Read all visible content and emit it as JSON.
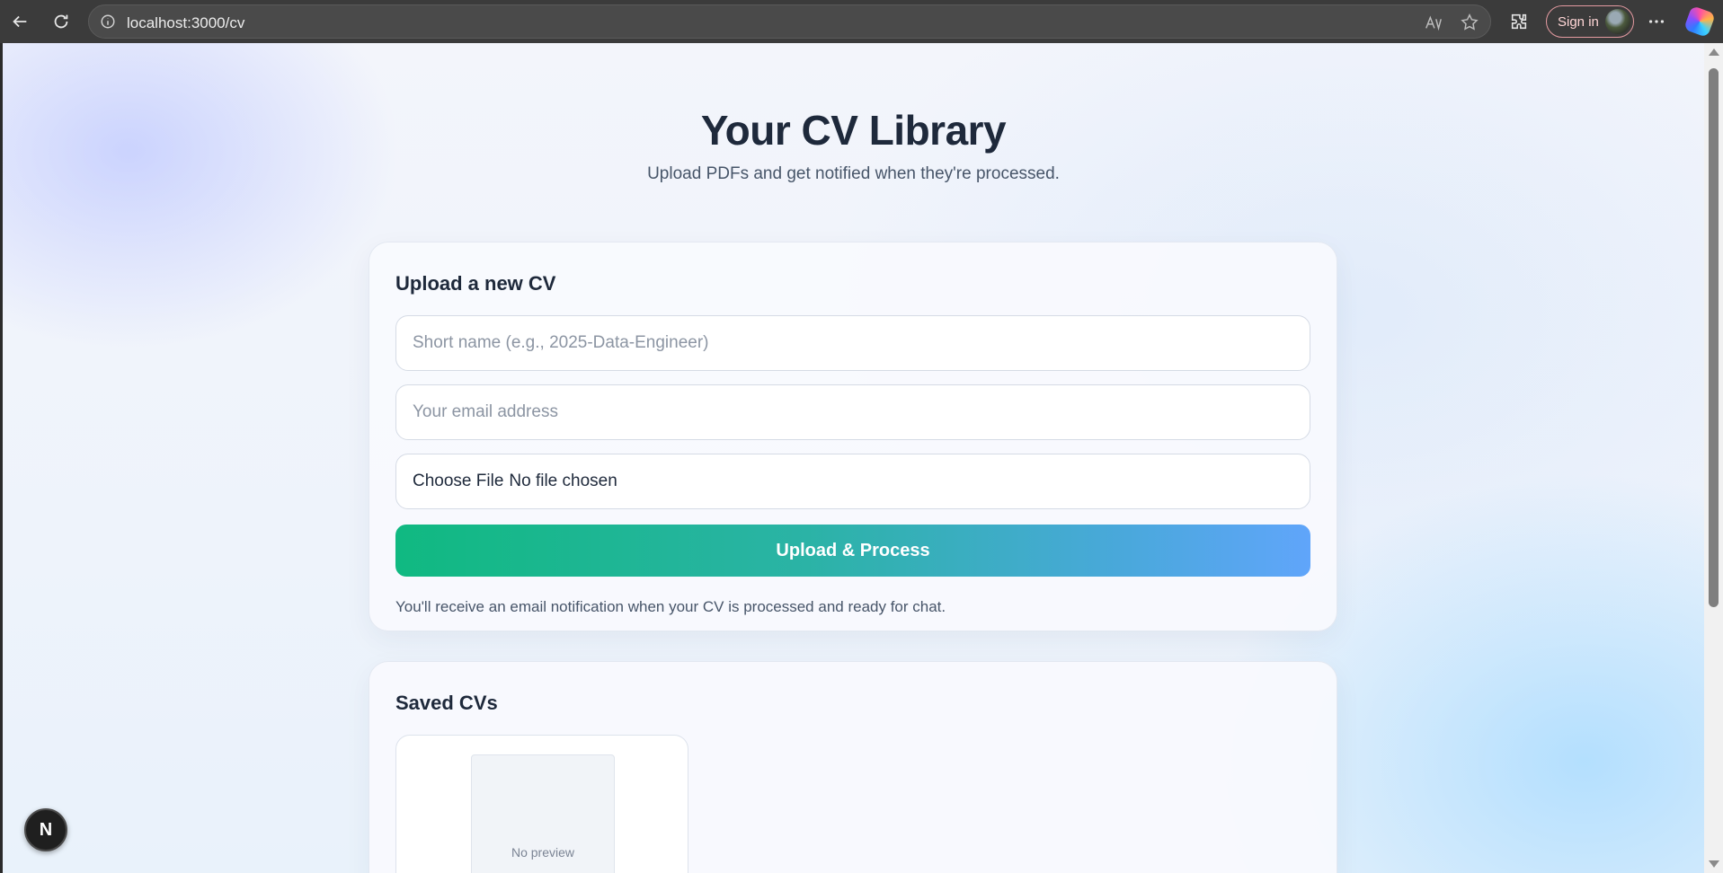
{
  "browser": {
    "url": "localhost:3000/cv",
    "sign_in_label": "Sign in"
  },
  "header": {
    "title": "Your CV Library",
    "subtitle": "Upload PDFs and get notified when they're processed."
  },
  "upload_card": {
    "heading": "Upload a new CV",
    "name_placeholder": "Short name (e.g., 2025-Data-Engineer)",
    "email_placeholder": "Your email address",
    "file_button_label": "Choose File",
    "file_status": "No file chosen",
    "submit_label": "Upload & Process",
    "note": "You'll receive an email notification when your CV is processed and ready for chat."
  },
  "saved_card": {
    "heading": "Saved CVs",
    "items": [
      {
        "preview_text": "No preview"
      }
    ]
  },
  "dev_badge": {
    "letter": "N"
  },
  "colors": {
    "accent_start": "#10b981",
    "accent_end": "#60a5fa",
    "text_primary": "#1e293b",
    "text_muted": "#475569"
  }
}
